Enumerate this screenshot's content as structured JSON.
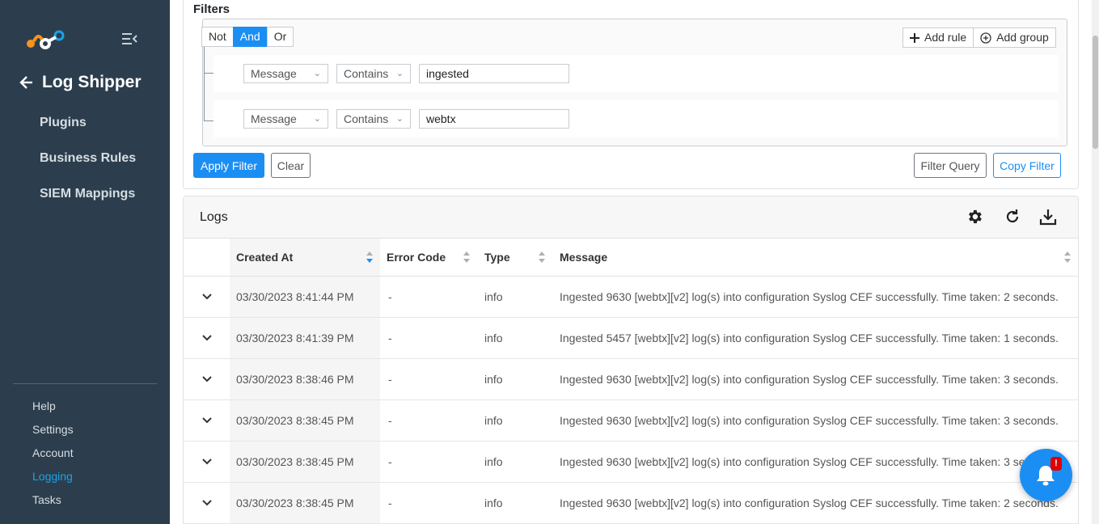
{
  "sidebar": {
    "page_title": "Log Shipper",
    "main_nav": [
      "Plugins",
      "Business Rules",
      "SIEM Mappings"
    ],
    "bottom_nav": [
      {
        "label": "Help",
        "active": false
      },
      {
        "label": "Settings",
        "active": false
      },
      {
        "label": "Account",
        "active": false
      },
      {
        "label": "Logging",
        "active": true
      },
      {
        "label": "Tasks",
        "active": false
      }
    ]
  },
  "filters": {
    "title": "Filters",
    "conjunctions": [
      "Not",
      "And",
      "Or"
    ],
    "active_conjunction": "And",
    "add_rule_label": "Add rule",
    "add_group_label": "Add group",
    "rules": [
      {
        "field": "Message",
        "operator": "Contains",
        "value": "ingested"
      },
      {
        "field": "Message",
        "operator": "Contains",
        "value": "webtx"
      }
    ],
    "apply_label": "Apply Filter",
    "clear_label": "Clear",
    "filter_query_label": "Filter Query",
    "copy_filter_label": "Copy Filter"
  },
  "logs": {
    "title": "Logs",
    "columns": [
      "Created At",
      "Error Code",
      "Type",
      "Message"
    ],
    "rows": [
      {
        "created_at": "03/30/2023 8:41:44 PM",
        "error_code": "-",
        "type": "info",
        "message": "Ingested 9630 [webtx][v2] log(s) into configuration Syslog CEF successfully. Time taken: 2 seconds."
      },
      {
        "created_at": "03/30/2023 8:41:39 PM",
        "error_code": "-",
        "type": "info",
        "message": "Ingested 5457 [webtx][v2] log(s) into configuration Syslog CEF successfully. Time taken: 1 seconds."
      },
      {
        "created_at": "03/30/2023 8:38:46 PM",
        "error_code": "-",
        "type": "info",
        "message": "Ingested 9630 [webtx][v2] log(s) into configuration Syslog CEF successfully. Time taken: 3 seconds."
      },
      {
        "created_at": "03/30/2023 8:38:45 PM",
        "error_code": "-",
        "type": "info",
        "message": "Ingested 9630 [webtx][v2] log(s) into configuration Syslog CEF successfully. Time taken: 3 seconds."
      },
      {
        "created_at": "03/30/2023 8:38:45 PM",
        "error_code": "-",
        "type": "info",
        "message": "Ingested 9630 [webtx][v2] log(s) into configuration Syslog CEF successfully. Time taken: 3 seconds."
      },
      {
        "created_at": "03/30/2023 8:38:45 PM",
        "error_code": "-",
        "type": "info",
        "message": "Ingested 9630 [webtx][v2] log(s) into configuration Syslog CEF successfully. Time taken: 2 seconds."
      }
    ]
  },
  "notification": {
    "badge": "!"
  },
  "colors": {
    "sidebar_bg": "#2c3e4d",
    "accent": "#1b8ef3",
    "logo_orange": "#f7931e",
    "active_nav": "#1ba2e8",
    "badge": "#e00000"
  },
  "icons": {
    "logo": "logo-icon",
    "collapse": "menu-collapse-icon",
    "back": "arrow-left-icon",
    "add_rule": "plus-icon",
    "add_group": "plus-circle-icon",
    "settings": "gear-icon",
    "refresh": "refresh-icon",
    "download": "download-icon",
    "expand": "chevron-down-icon",
    "sort": "sort-icon",
    "notification": "bell-icon"
  }
}
